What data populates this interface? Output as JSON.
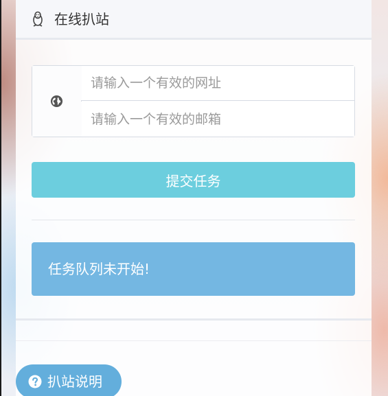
{
  "header": {
    "title": "在线扒站",
    "icon": "penguin-icon"
  },
  "form": {
    "addon_icon": "globe-icon",
    "url_placeholder": "请输入一个有效的网址",
    "url_value": "",
    "email_placeholder": "请输入一个有效的邮箱",
    "email_value": "",
    "submit_label": "提交任务"
  },
  "status": {
    "message": "任务队列未开始!"
  },
  "help": {
    "label": "扒站说明",
    "icon": "question-circle-icon"
  },
  "colors": {
    "submit_bg": "#6ccede",
    "alert_bg": "#74b7e2",
    "help_bg": "#63aedc"
  }
}
